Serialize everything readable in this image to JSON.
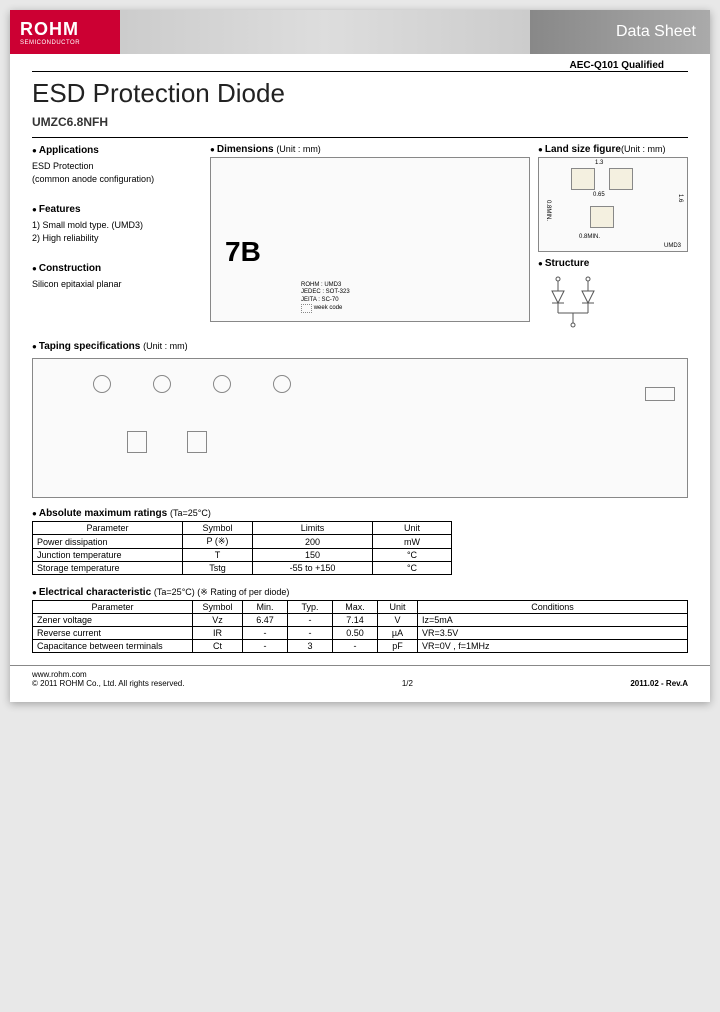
{
  "header": {
    "logo_main": "ROHM",
    "logo_sub": "SEMICONDUCTOR",
    "doc_type": "Data Sheet"
  },
  "qualification": "AEC-Q101 Qualified",
  "title": "ESD Protection Diode",
  "part_number": "UMZC6.8NFH",
  "applications": {
    "heading": "Applications",
    "line1": "ESD Protection",
    "line2": "(common anode configuration)"
  },
  "features": {
    "heading": "Features",
    "item1": "1) Small mold type. (UMD3)",
    "item2": "2) High reliability"
  },
  "construction": {
    "heading": "Construction",
    "text": "Silicon epitaxial planar"
  },
  "dimensions": {
    "heading": "Dimensions",
    "unit": "(Unit : mm)",
    "marking": "7B",
    "pkg1": "ROHM : UMD3",
    "pkg2": "JEDEC : SOT-323",
    "pkg3": "JEITA : SC-70",
    "week": "week code"
  },
  "land": {
    "heading": "Land size figure",
    "unit": "(Unit : mm)",
    "w": "1.3",
    "h": "1.6",
    "gap": "0.65",
    "min1": "0.8MIN.",
    "min2": "0.8MIN.",
    "pkg": "UMD3"
  },
  "structure": {
    "heading": "Structure"
  },
  "taping": {
    "heading": "Taping specifications",
    "unit": "(Unit : mm)"
  },
  "abs_max": {
    "heading": "Absolute maximum ratings",
    "cond": "(Ta=25°C)",
    "cols": {
      "c1": "Parameter",
      "c2": "Symbol",
      "c3": "Limits",
      "c4": "Unit"
    },
    "rows": [
      {
        "p": "Power dissipation",
        "s": "P (※)",
        "l": "200",
        "u": "mW"
      },
      {
        "p": "Junction temperature",
        "s": "T",
        "l": "150",
        "u": "°C"
      },
      {
        "p": "Storage temperature",
        "s": "Tstg",
        "l": "-55 to +150",
        "u": "°C"
      }
    ]
  },
  "elec": {
    "heading": "Electrical characteristic",
    "cond": "(Ta=25°C)  (※ Rating of per diode)",
    "cols": {
      "c1": "Parameter",
      "c2": "Symbol",
      "c3": "Min.",
      "c4": "Typ.",
      "c5": "Max.",
      "c6": "Unit",
      "c7": "Conditions"
    },
    "rows": [
      {
        "p": "Zener voltage",
        "s": "Vz",
        "mn": "6.47",
        "ty": "-",
        "mx": "7.14",
        "u": "V",
        "c": "Iz=5mA"
      },
      {
        "p": "Reverse current",
        "s": "IR",
        "mn": "-",
        "ty": "-",
        "mx": "0.50",
        "u": "µA",
        "c": "VR=3.5V"
      },
      {
        "p": "Capacitance between terminals",
        "s": "Ct",
        "mn": "-",
        "ty": "3",
        "mx": "-",
        "u": "pF",
        "c": "VR=0V , f=1MHz"
      }
    ]
  },
  "footer": {
    "url": "www.rohm.com",
    "copy": "© 2011 ROHM Co., Ltd. All rights reserved.",
    "page": "1/2",
    "rev": "2011.02 -  Rev.A"
  }
}
